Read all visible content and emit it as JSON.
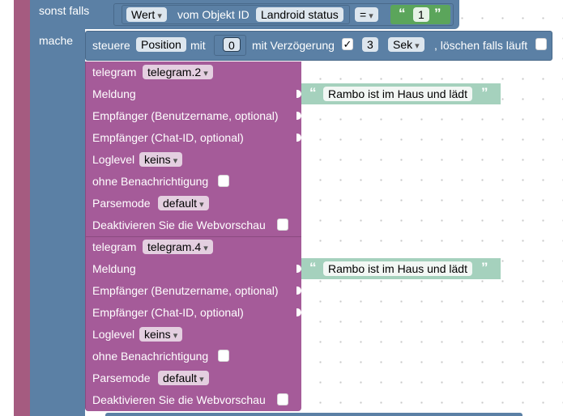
{
  "control_block": {
    "else_if_label": "sonst falls",
    "do_label": "mache"
  },
  "condition": {
    "attribute_value": "Wert",
    "from_object_label": "vom Objekt ID",
    "object_id": "Landroid status",
    "operator": "=",
    "compare_value": "1"
  },
  "control_statement": {
    "control_label": "steuere",
    "target": "Position",
    "with_label": "mit",
    "value": "0",
    "delay_label": "mit Verzögerung",
    "delay_checked_mark": "✓",
    "delay_amount": "3",
    "unit": "Sek",
    "clear_label": ", löschen falls läuft"
  },
  "telegram_blocks": [
    {
      "title": "telegram",
      "instance": "telegram.2",
      "message_label": "Meldung",
      "message": "Rambo ist im Haus und lädt",
      "recipient_user_label": "Empfänger (Benutzername, optional)",
      "recipient_chat_label": "Empfänger (Chat-ID, optional)",
      "loglevel_label": "Loglevel",
      "loglevel": "keins",
      "silent_label": "ohne Benachrichtigung",
      "parsemode_label": "Parsemode",
      "parsemode": "default",
      "disable_preview_label": "Deaktivieren Sie die Webvorschau"
    },
    {
      "title": "telegram",
      "instance": "telegram.4",
      "message_label": "Meldung",
      "message": "Rambo ist im Haus und lädt",
      "recipient_user_label": "Empfänger (Benutzername, optional)",
      "recipient_chat_label": "Empfänger (Chat-ID, optional)",
      "loglevel_label": "Loglevel",
      "loglevel": "keins",
      "silent_label": "ohne Benachrichtigung",
      "parsemode_label": "Parsemode",
      "parsemode": "default",
      "disable_preview_label": "Deaktivieren Sie die Webvorschau"
    }
  ],
  "colors": {
    "logic_block": "#5b80a5",
    "logic_block_dark": "#49698a",
    "telegram_block": "#a55b99",
    "telegram_block_dark": "#8a4a80",
    "text_block": "#a5d1bd",
    "outer_edge": "#a55b80",
    "field_bg": "#dde6ee"
  }
}
